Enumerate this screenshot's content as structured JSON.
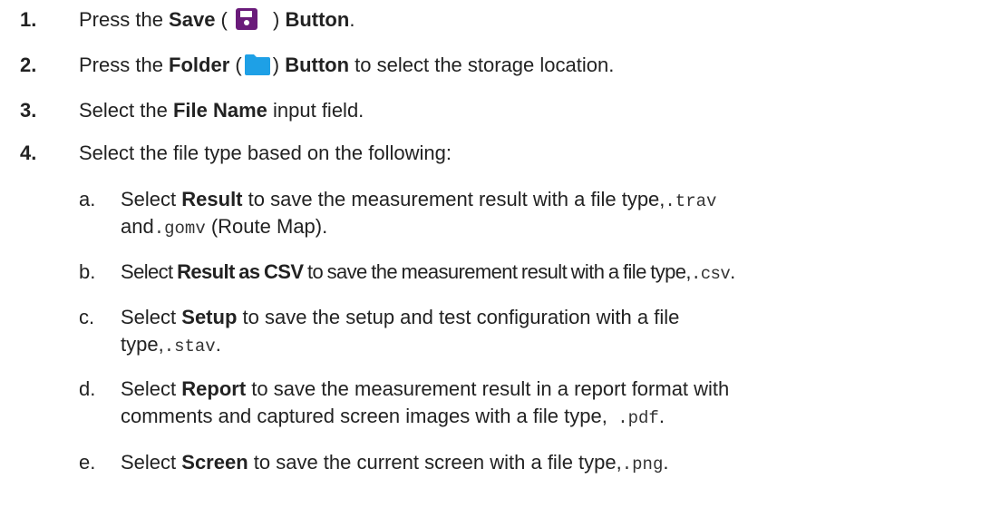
{
  "steps": [
    {
      "num": "1.",
      "t1": "Press the ",
      "b1": "Save",
      "t2": " (",
      "icon": "floppy-disk-save-icon",
      "t3": " ) ",
      "b2": "Button",
      "t4": "."
    },
    {
      "num": "2.",
      "t1": "Press the ",
      "b1": "Folder",
      "t2": " (",
      "icon": "folder-icon",
      "t3": ") ",
      "b2": "Button",
      "t4": " to select the storage location."
    },
    {
      "num": "3.",
      "t1": "Select the ",
      "b1": "File Name",
      "t2": " input field."
    },
    {
      "num": "4.",
      "t1": "Select the file type based on the following:"
    }
  ],
  "substeps": [
    {
      "letter": "a.",
      "t1": "Select ",
      "b1": "Result",
      "t2": " to save the measurement result with a file type,",
      "m1": ".trav",
      "line2_t1": "and",
      "m2": ".gomv",
      "line2_t2": " (Route Map)."
    },
    {
      "letter": "b.",
      "t1": "Select ",
      "b1": "Result as CSV",
      "t2": " to save the measurement result with a file type,",
      "m1": ".csv",
      "t3": "."
    },
    {
      "letter": "c.",
      "t1": "Select ",
      "b1": "Setup",
      "t2": " to save the setup and test configuration with a file",
      "line2_t1": "type,",
      "m1": ".stav",
      "line2_t2": "."
    },
    {
      "letter": "d.",
      "t1": "Select ",
      "b1": "Report",
      "t2": " to save the measurement result in a report format with",
      "line2_t1": "comments and captured  screen images with a file type,",
      "m1": " .pdf",
      "line2_t2": "."
    },
    {
      "letter": "e.",
      "t1": "Select ",
      "b1": "Screen",
      "t2": " to save the current screen with a file type,",
      "m1": ".png",
      "t3": "."
    }
  ],
  "colors": {
    "save_icon": "#6a1b7a",
    "folder_icon": "#1ea0e6"
  }
}
